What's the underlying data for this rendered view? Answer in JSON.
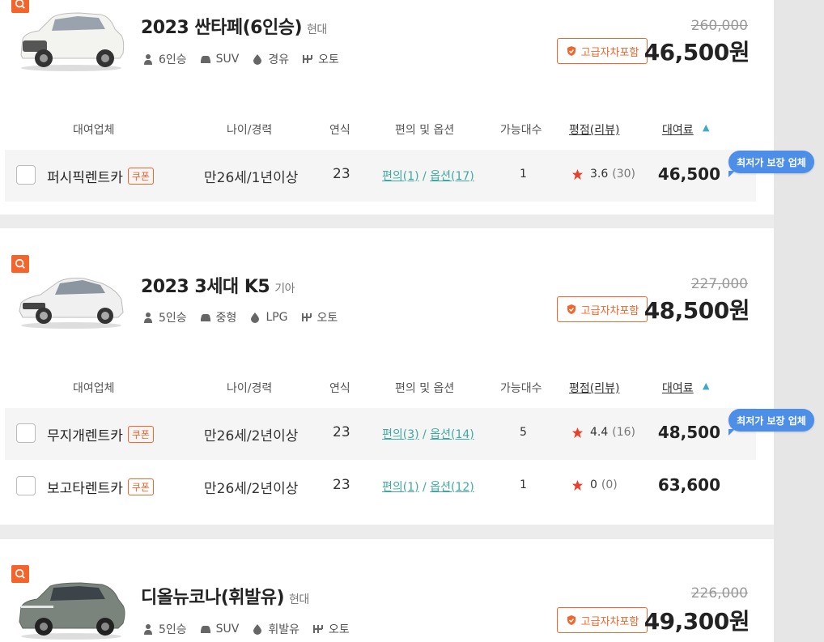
{
  "headers": {
    "company": "대여업체",
    "age": "나이/경력",
    "year": "연식",
    "options": "편의 및 옵션",
    "available": "가능대수",
    "rating": "평점(리뷰)",
    "price": "대여료"
  },
  "best_tag": "최저가 보장 업체",
  "premium_badge": "고급자차포함",
  "coupon": "쿠폰",
  "cars": [
    {
      "title": "2023 싼타페(6인승)",
      "maker": "현대",
      "seats": "6인승",
      "type": "SUV",
      "fuel": "경유",
      "transmission": "오토",
      "original_price": "260,000",
      "price": "46,500원",
      "rows": [
        {
          "company": "퍼시픽렌트카",
          "age": "만26세/1년이상",
          "year": "23",
          "conv": "편의(1)",
          "opt": "옵션(17)",
          "qty": "1",
          "rating": "3.6",
          "reviews": "(30)",
          "price": "46,500"
        }
      ]
    },
    {
      "title": "2023 3세대 K5",
      "maker": "기아",
      "seats": "5인승",
      "type": "중형",
      "fuel": "LPG",
      "transmission": "오토",
      "original_price": "227,000",
      "price": "48,500원",
      "rows": [
        {
          "company": "무지개렌트카",
          "age": "만26세/2년이상",
          "year": "23",
          "conv": "편의(3)",
          "opt": "옵션(14)",
          "qty": "5",
          "rating": "4.4",
          "reviews": "(16)",
          "price": "48,500"
        },
        {
          "company": "보고타렌트카",
          "age": "만26세/2년이상",
          "year": "23",
          "conv": "편의(1)",
          "opt": "옵션(12)",
          "qty": "1",
          "rating": "0",
          "reviews": "(0)",
          "price": "63,600"
        }
      ]
    },
    {
      "title": "디올뉴코나(휘발유)",
      "maker": "현대",
      "seats": "5인승",
      "type": "SUV",
      "fuel": "휘발유",
      "transmission": "오토",
      "original_price": "226,000",
      "price": "49,300원",
      "rows": []
    }
  ],
  "colors": {
    "accent": "#f4642b",
    "link": "#3fa9a0",
    "tag": "#4c8ee8",
    "star": "#e8402a"
  }
}
